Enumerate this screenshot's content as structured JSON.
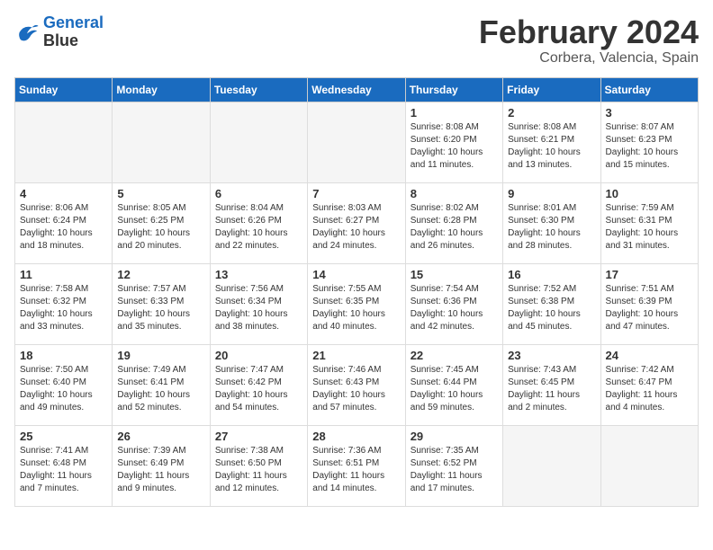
{
  "header": {
    "logo_line1": "General",
    "logo_line2": "Blue",
    "month_title": "February 2024",
    "location": "Corbera, Valencia, Spain"
  },
  "weekdays": [
    "Sunday",
    "Monday",
    "Tuesday",
    "Wednesday",
    "Thursday",
    "Friday",
    "Saturday"
  ],
  "weeks": [
    [
      {
        "day": "",
        "empty": true
      },
      {
        "day": "",
        "empty": true
      },
      {
        "day": "",
        "empty": true
      },
      {
        "day": "",
        "empty": true
      },
      {
        "day": "1",
        "sunrise": "8:08 AM",
        "sunset": "6:20 PM",
        "daylight": "10 hours and 11 minutes."
      },
      {
        "day": "2",
        "sunrise": "8:08 AM",
        "sunset": "6:21 PM",
        "daylight": "10 hours and 13 minutes."
      },
      {
        "day": "3",
        "sunrise": "8:07 AM",
        "sunset": "6:23 PM",
        "daylight": "10 hours and 15 minutes."
      }
    ],
    [
      {
        "day": "4",
        "sunrise": "8:06 AM",
        "sunset": "6:24 PM",
        "daylight": "10 hours and 18 minutes."
      },
      {
        "day": "5",
        "sunrise": "8:05 AM",
        "sunset": "6:25 PM",
        "daylight": "10 hours and 20 minutes."
      },
      {
        "day": "6",
        "sunrise": "8:04 AM",
        "sunset": "6:26 PM",
        "daylight": "10 hours and 22 minutes."
      },
      {
        "day": "7",
        "sunrise": "8:03 AM",
        "sunset": "6:27 PM",
        "daylight": "10 hours and 24 minutes."
      },
      {
        "day": "8",
        "sunrise": "8:02 AM",
        "sunset": "6:28 PM",
        "daylight": "10 hours and 26 minutes."
      },
      {
        "day": "9",
        "sunrise": "8:01 AM",
        "sunset": "6:30 PM",
        "daylight": "10 hours and 28 minutes."
      },
      {
        "day": "10",
        "sunrise": "7:59 AM",
        "sunset": "6:31 PM",
        "daylight": "10 hours and 31 minutes."
      }
    ],
    [
      {
        "day": "11",
        "sunrise": "7:58 AM",
        "sunset": "6:32 PM",
        "daylight": "10 hours and 33 minutes."
      },
      {
        "day": "12",
        "sunrise": "7:57 AM",
        "sunset": "6:33 PM",
        "daylight": "10 hours and 35 minutes."
      },
      {
        "day": "13",
        "sunrise": "7:56 AM",
        "sunset": "6:34 PM",
        "daylight": "10 hours and 38 minutes."
      },
      {
        "day": "14",
        "sunrise": "7:55 AM",
        "sunset": "6:35 PM",
        "daylight": "10 hours and 40 minutes."
      },
      {
        "day": "15",
        "sunrise": "7:54 AM",
        "sunset": "6:36 PM",
        "daylight": "10 hours and 42 minutes."
      },
      {
        "day": "16",
        "sunrise": "7:52 AM",
        "sunset": "6:38 PM",
        "daylight": "10 hours and 45 minutes."
      },
      {
        "day": "17",
        "sunrise": "7:51 AM",
        "sunset": "6:39 PM",
        "daylight": "10 hours and 47 minutes."
      }
    ],
    [
      {
        "day": "18",
        "sunrise": "7:50 AM",
        "sunset": "6:40 PM",
        "daylight": "10 hours and 49 minutes."
      },
      {
        "day": "19",
        "sunrise": "7:49 AM",
        "sunset": "6:41 PM",
        "daylight": "10 hours and 52 minutes."
      },
      {
        "day": "20",
        "sunrise": "7:47 AM",
        "sunset": "6:42 PM",
        "daylight": "10 hours and 54 minutes."
      },
      {
        "day": "21",
        "sunrise": "7:46 AM",
        "sunset": "6:43 PM",
        "daylight": "10 hours and 57 minutes."
      },
      {
        "day": "22",
        "sunrise": "7:45 AM",
        "sunset": "6:44 PM",
        "daylight": "10 hours and 59 minutes."
      },
      {
        "day": "23",
        "sunrise": "7:43 AM",
        "sunset": "6:45 PM",
        "daylight": "11 hours and 2 minutes."
      },
      {
        "day": "24",
        "sunrise": "7:42 AM",
        "sunset": "6:47 PM",
        "daylight": "11 hours and 4 minutes."
      }
    ],
    [
      {
        "day": "25",
        "sunrise": "7:41 AM",
        "sunset": "6:48 PM",
        "daylight": "11 hours and 7 minutes."
      },
      {
        "day": "26",
        "sunrise": "7:39 AM",
        "sunset": "6:49 PM",
        "daylight": "11 hours and 9 minutes."
      },
      {
        "day": "27",
        "sunrise": "7:38 AM",
        "sunset": "6:50 PM",
        "daylight": "11 hours and 12 minutes."
      },
      {
        "day": "28",
        "sunrise": "7:36 AM",
        "sunset": "6:51 PM",
        "daylight": "11 hours and 14 minutes."
      },
      {
        "day": "29",
        "sunrise": "7:35 AM",
        "sunset": "6:52 PM",
        "daylight": "11 hours and 17 minutes."
      },
      {
        "day": "",
        "empty": true
      },
      {
        "day": "",
        "empty": true
      }
    ]
  ]
}
